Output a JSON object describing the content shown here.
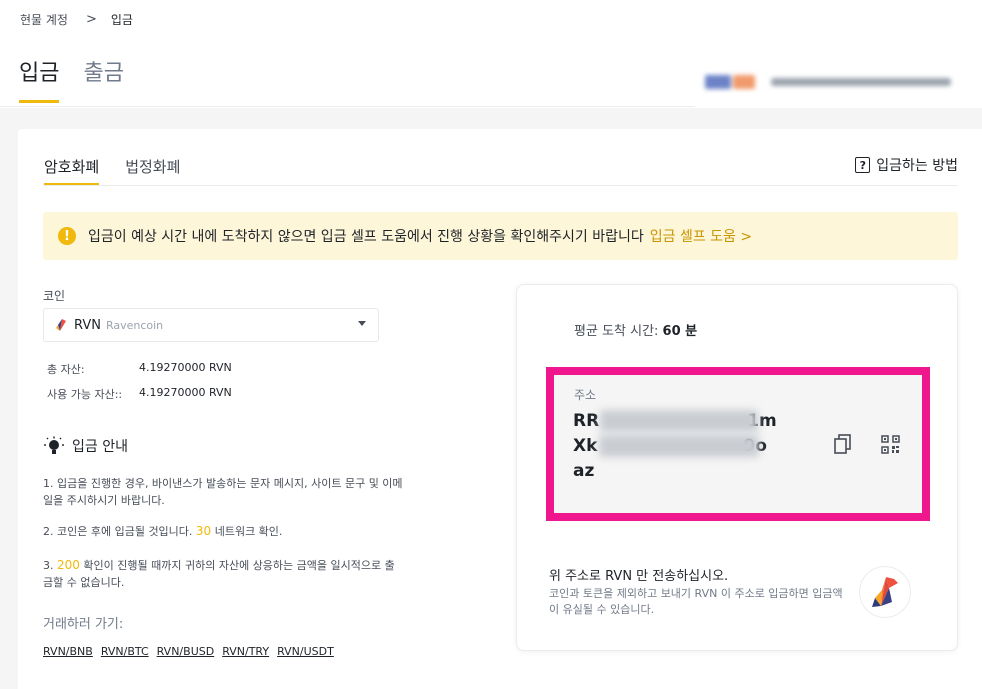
{
  "breadcrumb": {
    "parent": "현물 계정",
    "separator": ">",
    "current": "입금"
  },
  "main_tabs": [
    {
      "label": "입금",
      "active": true
    },
    {
      "label": "출금",
      "active": false
    }
  ],
  "sub_tabs": [
    {
      "label": "암호화폐",
      "active": true
    },
    {
      "label": "법정화폐",
      "active": false
    }
  ],
  "howto": {
    "label": "입금하는 방법",
    "icon": "question-doc-icon"
  },
  "notice": {
    "icon": "warning-icon",
    "text": "입금이 예상 시간 내에 도착하지 않으면 입금 셀프 도움에서 진행 상황을 확인해주시기 바랍니다",
    "link": "입금 셀프 도움 >"
  },
  "coin": {
    "label": "코인",
    "symbol": "RVN",
    "name": "Ravencoin",
    "total_label": "총 자산:",
    "total_value": "4.19270000 RVN",
    "available_label": "사용 가능 자산::",
    "available_value": "4.19270000 RVN"
  },
  "guide": {
    "title": "입금 안내",
    "item1": "1. 입금을 진행한 경우, 바이낸스가 발송하는 문자 메시지, 사이트 문구 및 이메일을 주시하시기 바랍니다.",
    "item2_prefix": "2. 코인은 후에 입금될 것입니다.",
    "item2_num": "30",
    "item2_suffix": "네트워크 확인.",
    "item3_prefix": "3.",
    "item3_num": "200",
    "item3_suffix": "확인이 진행될 때까지 귀하의 자산에 상응하는 금액을 일시적으로 출금할 수 없습니다."
  },
  "trade": {
    "label": "거래하러 가기:",
    "pairs": [
      "RVN/BNB",
      "RVN/BTC",
      "RVN/BUSD",
      "RVN/TRY",
      "RVN/USDT"
    ]
  },
  "deposit": {
    "avg_label": "평균 도착 시간:",
    "avg_value": "60 분",
    "address_label": "주소",
    "addr_line1_start": "RR",
    "addr_line1_end": "1m",
    "addr_line2_start": "Xk",
    "addr_line2_end": "9o",
    "addr_line3": "az",
    "send_only": "위 주소로 RVN 만 전송하십시오.",
    "warning": "코인과 토큰을 제외하고 보내기 RVN 이 주소로 입금하면 입금액이 유실될 수 있습니다.",
    "highlight_color": "#f0178e"
  },
  "colors": {
    "accent": "#f0b90b",
    "link": "#c99400",
    "notice_bg": "#fdf6d8"
  }
}
